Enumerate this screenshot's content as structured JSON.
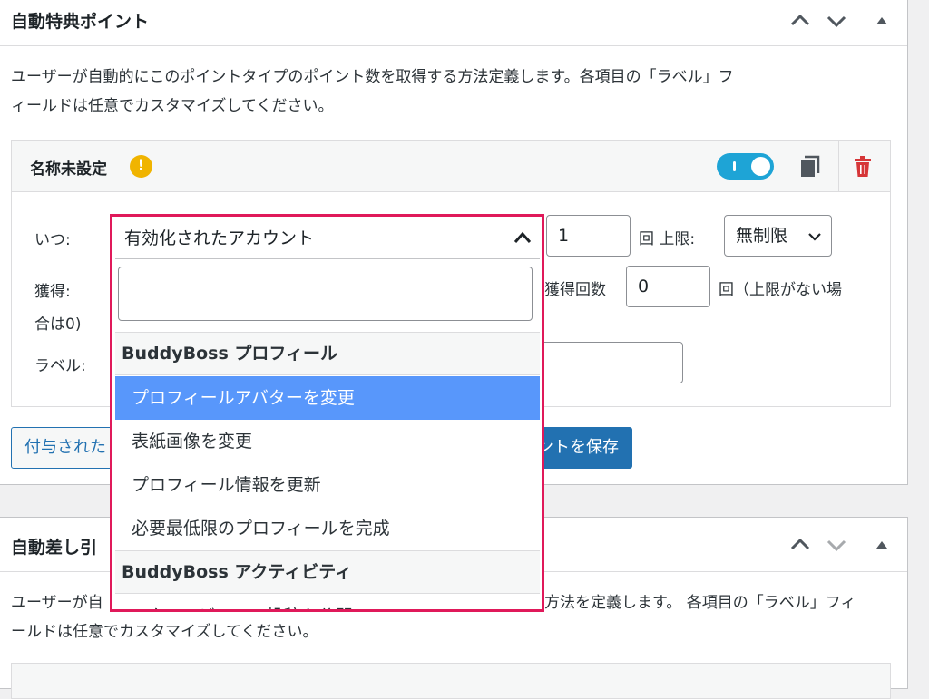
{
  "panel1": {
    "title": "自動特典ポイント",
    "description_line1": "ユーザーが自動的にこのポイントタイプのポイント数を取得する方法定義します。各項目の「ラベル」フ",
    "description_line2": "ィールドは任意でカスタマイズしてください。",
    "item": {
      "name": "名称未設定",
      "warning_symbol": "!",
      "toggle_on": true,
      "when_label": "いつ:",
      "earn_label": "獲得:",
      "earn_label_cont": "合は0)",
      "label_label": "ラベル:",
      "count_value": "1",
      "limit_text": "回 上限:",
      "limit_select": "無制限",
      "max_earn_text": "獲得回数",
      "max_earn_value": "0",
      "max_earn_suffix": "回（上限がない場",
      "label_value": ""
    },
    "buttons": {
      "secondary_label": "付与された",
      "primary_label": "イントを保存"
    }
  },
  "panel2": {
    "title": "自動差し引",
    "description_line1_left": "ユーザーが自",
    "description_line1_right": "方法を定義します。 各項目の「ラベル」フィ",
    "description_line2": "ールドは任意でカスタマイズしてください。"
  },
  "dropdown": {
    "selected": "有効化されたアカウント",
    "search_value": "",
    "groups": [
      {
        "label": "BuddyBoss プロフィール",
        "options": [
          {
            "label": "プロフィールアバターを変更",
            "active": true
          },
          {
            "label": "表紙画像を変更",
            "active": false
          },
          {
            "label": "プロフィール情報を更新",
            "active": false
          },
          {
            "label": "必要最低限のプロフィールを完成",
            "active": false
          }
        ]
      },
      {
        "label": "BuddyBoss アクティビティ",
        "options": [
          {
            "label": "アクティビティの投稿を公開",
            "active": false
          }
        ]
      }
    ]
  },
  "colors": {
    "highlight_border": "#e0195a",
    "active_option": "#5897fb",
    "toggle": "#1ea4d6",
    "primary_button": "#2271b1",
    "warning": "#f0b400",
    "trash": "#d63638"
  },
  "icons": {
    "collapse_up": "chevron-up-icon",
    "expand_down": "chevron-down-icon",
    "toggle_panel": "triangle-up-icon",
    "duplicate": "copy-icon",
    "delete": "trash-icon",
    "warning": "warning-icon"
  }
}
